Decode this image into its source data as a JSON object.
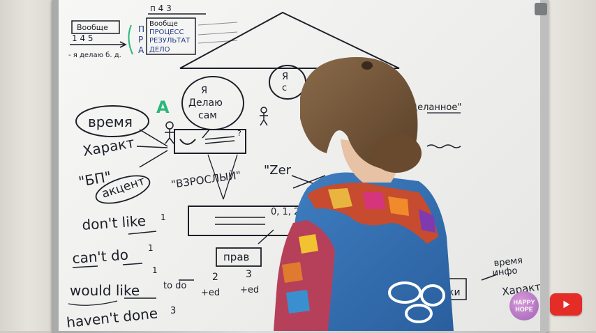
{
  "board": {
    "top_box_title": "Вообще",
    "top_box_numbers": "1 4 5",
    "top_box_arrow_caption": "- я делаю б. д.",
    "letters_column": [
      "П",
      "Р",
      "А"
    ],
    "column_head_numbers": "п 4 3",
    "column_box_rows": [
      "Вообще",
      "ПРОЦЕСС",
      "РЕЗУЛЬТАТ",
      "ДЕЛО"
    ],
    "center_bubble_left": [
      "Я",
      "Делаю",
      "сам"
    ],
    "center_bubble_right": [
      "Я",
      "с"
    ],
    "circle_word": "время",
    "left_words": [
      "Характ",
      "\"БП\"",
      "акцент"
    ],
    "letter_a": "А",
    "adult_label": "\"ВЗРОСЛЫЙ\"",
    "zero_label": "\"Zer",
    "timeline_label": "0, 1, 2, 3",
    "small_box_label": "прав",
    "done_label": "\"сделанное\"",
    "phrase_1": "don't like",
    "phrase_1_sup": "1",
    "phrase_2": "can't do",
    "phrase_2_sup": "1",
    "phrase_3": "would like",
    "phrase_3_mid": "to do",
    "phrase_3_sup": "1",
    "numbers_row": [
      "2",
      "3"
    ],
    "ed_row": [
      "+ed",
      "+ed"
    ],
    "phrase_4": "haven't done",
    "phrase_4_sup": "3",
    "right_side_words": [
      "время",
      "инфо",
      "Характ"
    ],
    "right_side_box_end": "ки",
    "question_mark": "?"
  },
  "overlay": {
    "logo_text_1": "HAPPY",
    "logo_text_2": "HOPE",
    "youtube_icon": "play-icon"
  }
}
